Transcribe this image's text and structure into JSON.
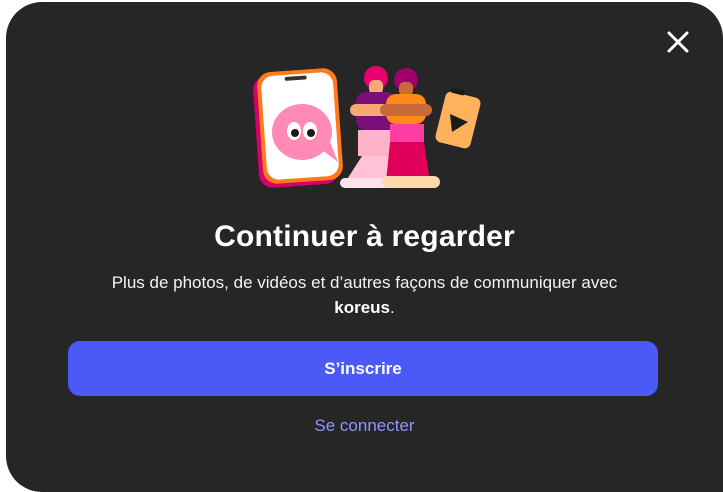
{
  "dialog": {
    "title": "Continuer à regarder",
    "subtitle_text": "Plus de photos, de vidéos et d’autres façons de communiquer avec",
    "channel_name": "koreus",
    "subtitle_end": ".",
    "signup_label": "S’inscrire",
    "login_label": "Se connecter",
    "close_icon": "close-icon",
    "illustration": "characters-phone-chat-illustration"
  },
  "colors": {
    "background": "#262626",
    "primary_button": "#4b59f7",
    "link": "#8e96ff",
    "text": "#ffffff"
  }
}
